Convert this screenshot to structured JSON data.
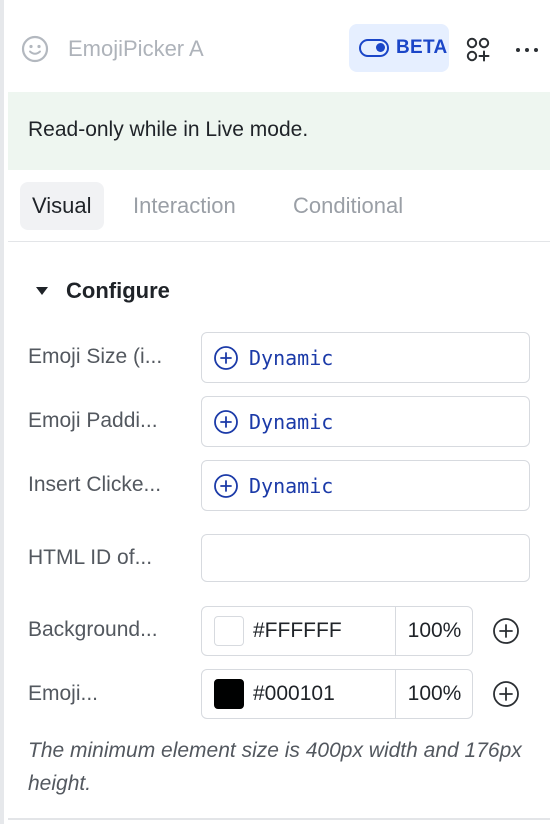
{
  "header": {
    "component_name": "EmojiPicker A",
    "beta_label": "BETA",
    "icons": [
      "smiley-icon",
      "toggle-icon",
      "component-grid-icon",
      "more-icon"
    ]
  },
  "notice": {
    "text": "Read-only while in Live mode."
  },
  "tabs": [
    {
      "label": "Visual",
      "active": true
    },
    {
      "label": "Interaction",
      "active": false
    },
    {
      "label": "Conditional",
      "active": false
    }
  ],
  "section": {
    "title": "Configure",
    "expanded": true
  },
  "properties": {
    "emoji_size": {
      "label": "Emoji Size (i...",
      "value": "Dynamic"
    },
    "emoji_padding": {
      "label": "Emoji Paddi...",
      "value": "Dynamic"
    },
    "insert_clicked": {
      "label": "Insert Clicke...",
      "value": "Dynamic"
    },
    "html_id": {
      "label": "HTML ID of...",
      "value": ""
    },
    "background": {
      "label": "Background...",
      "hex": "#FFFFFF",
      "opacity": "100%"
    },
    "emoji_color": {
      "label": "Emoji...",
      "hex": "#000101",
      "opacity": "100%"
    }
  },
  "hint": "The minimum element size is 400px width and 176px height.",
  "colors": {
    "accent": "#1b46c8",
    "beta_bg": "#e6efff",
    "notice_bg": "#eef6f0",
    "dynamic_text": "#1b3aa8",
    "background_swatch": "#FFFFFF",
    "emoji_swatch": "#000101"
  }
}
